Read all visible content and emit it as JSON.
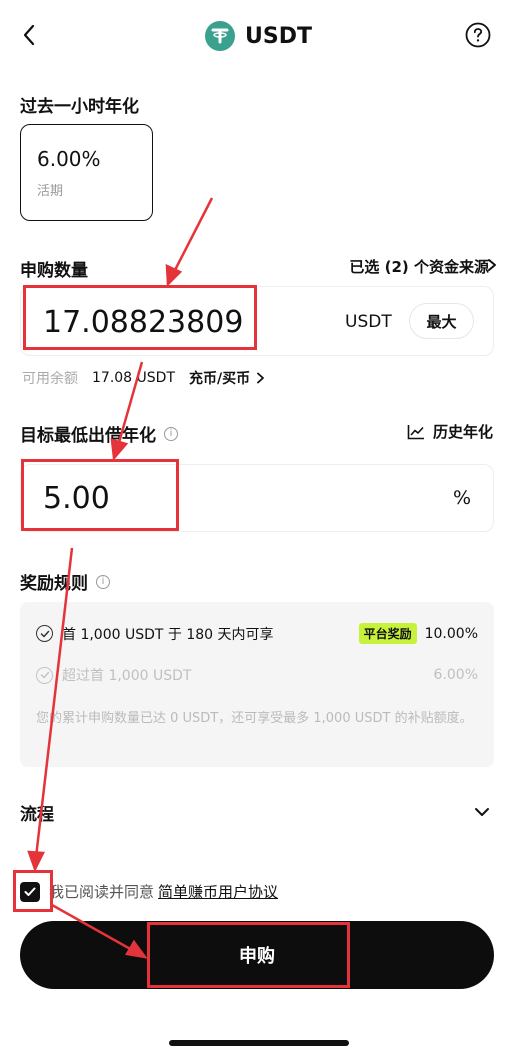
{
  "header": {
    "title": "USDT",
    "coin_icon": "tether-logo",
    "back_icon": "chevron-left-icon",
    "help_icon": "question-circle-icon"
  },
  "apy": {
    "label": "过去一小时年化",
    "value": "6.00%",
    "type": "活期"
  },
  "amount": {
    "label": "申购数量",
    "sources": "已选 (2) 个资金来源",
    "value": "17.08823809",
    "unit": "USDT",
    "max_label": "最大"
  },
  "balance": {
    "label": "可用余额",
    "value": "17.08 USDT",
    "topup_label": "充币/买币"
  },
  "target_rate": {
    "label": "目标最低出借年化",
    "history_label": "历史年化",
    "value": "5.00",
    "unit": "%"
  },
  "rules": {
    "label": "奖励规则",
    "items": [
      {
        "text": "首 1,000 USDT 于 180 天内可享",
        "badge": "平台奖励",
        "pct": "10.00%"
      },
      {
        "text": "超过首 1,000 USDT",
        "pct": "6.00%"
      }
    ],
    "note": "您的累计申购数量已达 0 USDT，还可享受最多 1,000 USDT 的补贴额度。"
  },
  "flow": {
    "label": "流程"
  },
  "agreement": {
    "checked": true,
    "text": "我已阅读并同意",
    "link": "简单赚币用户协议"
  },
  "submit": {
    "label": "申购"
  },
  "colors": {
    "accent_badge": "#c7f23c",
    "primary_button": "#0d0d0d",
    "annotation_red": "#e4343a",
    "coin": "#3aa18e"
  }
}
